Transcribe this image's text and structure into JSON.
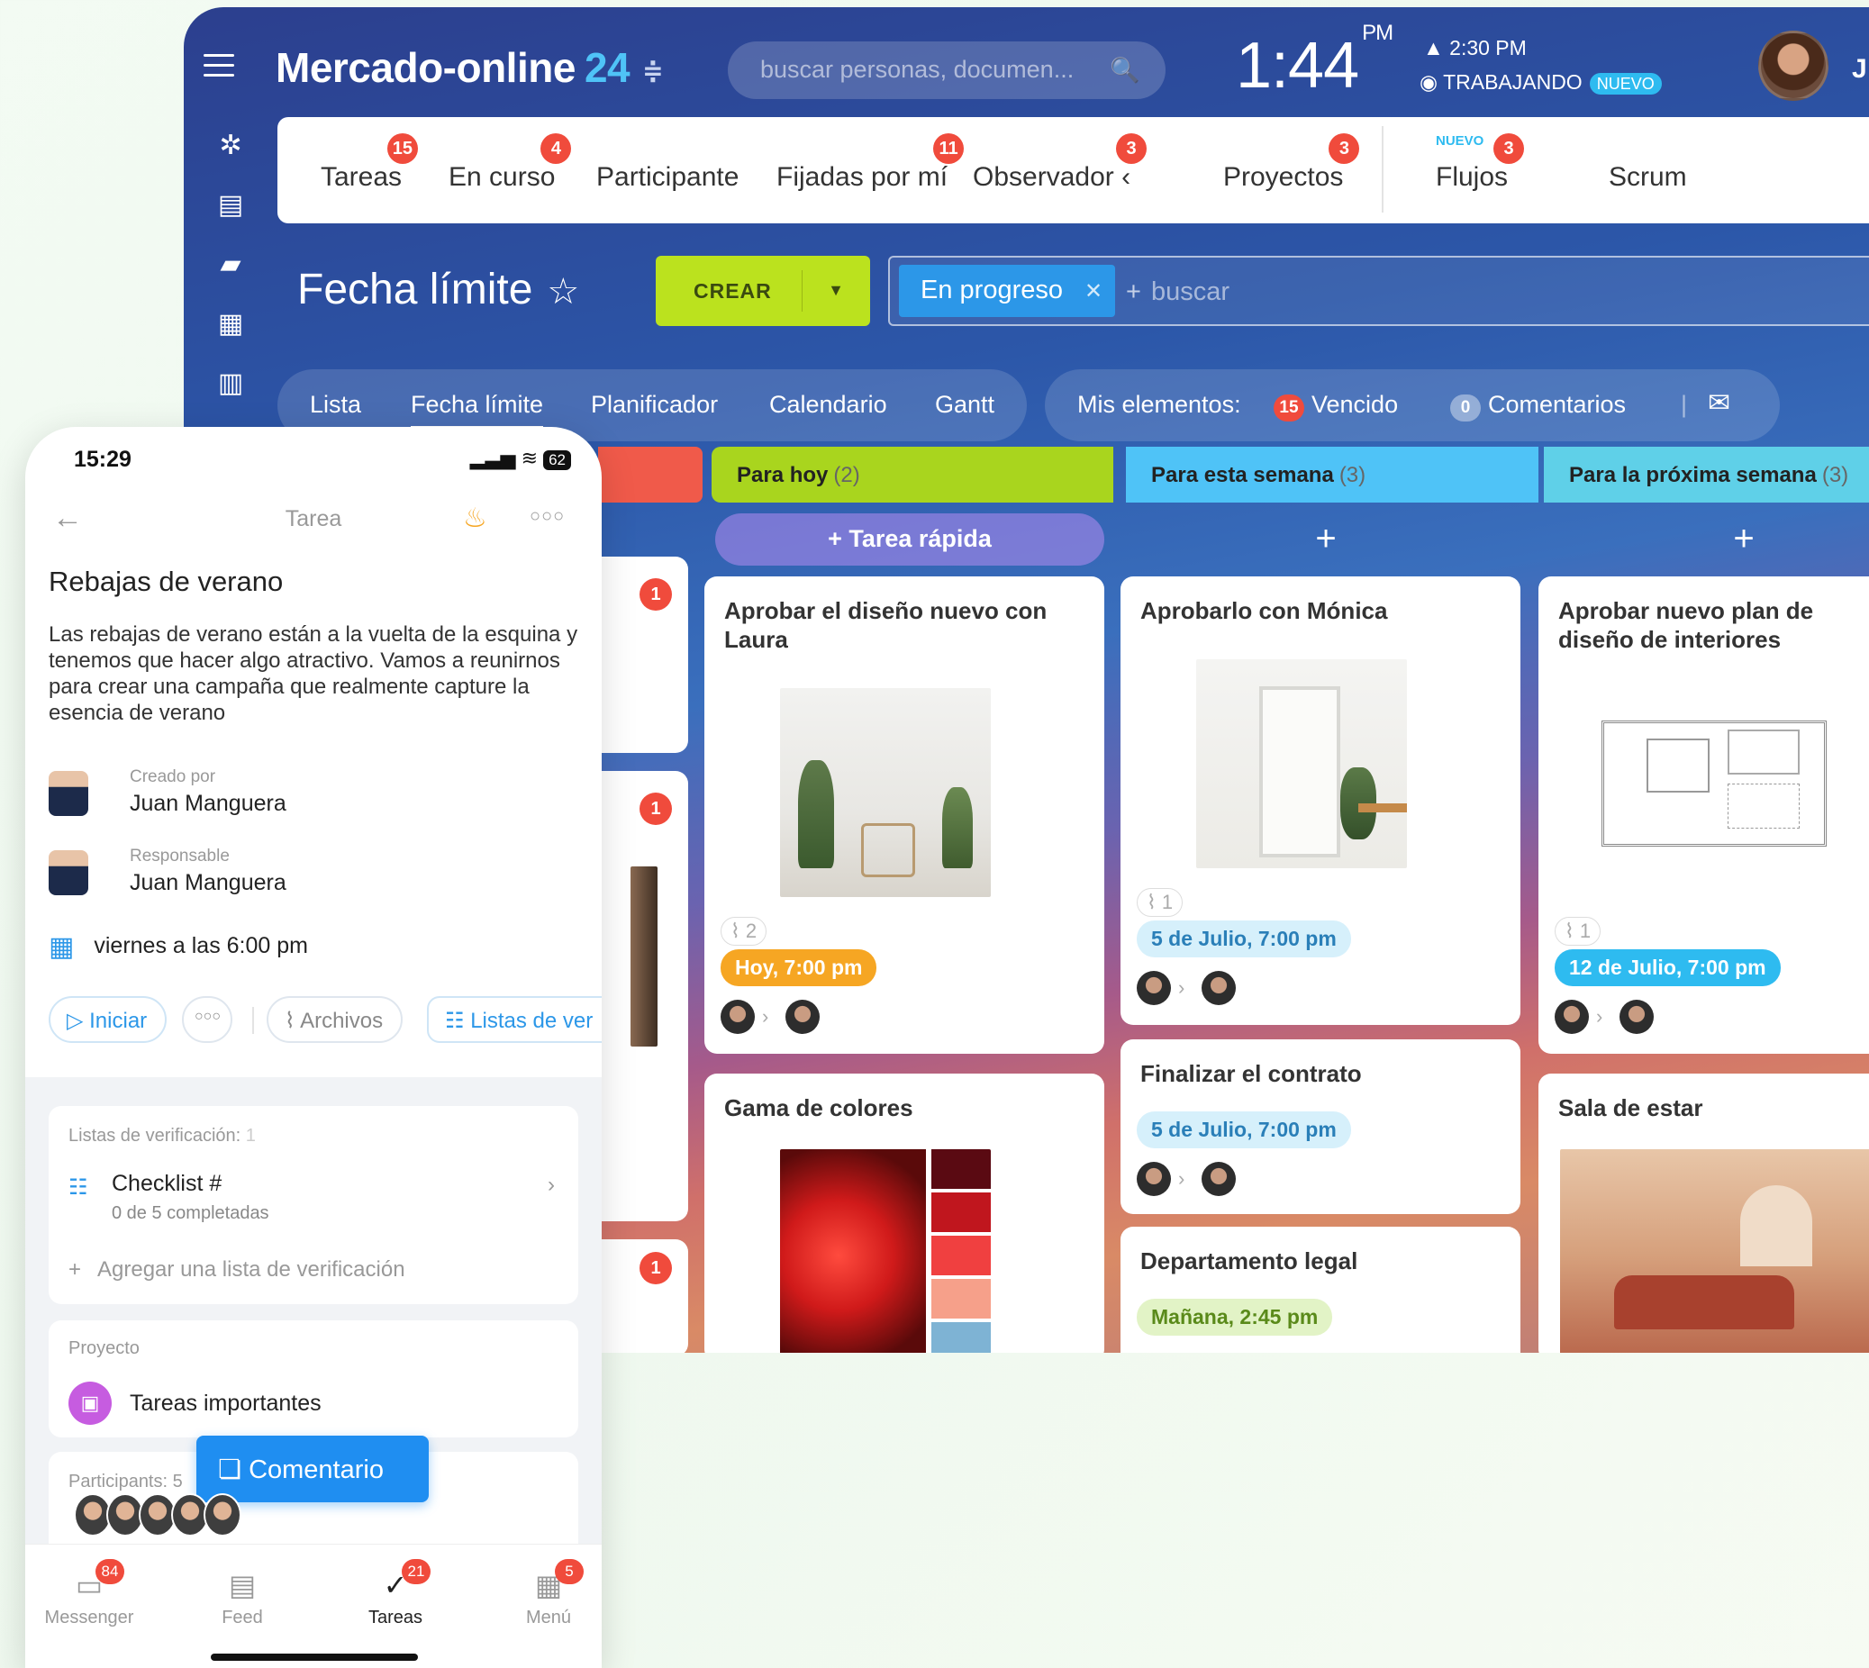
{
  "desktop": {
    "brand": "Mercado-online",
    "brand_num": "24",
    "search_placeholder": "buscar personas, documen...",
    "clock": "1:44",
    "clock_suffix": "PM",
    "alarm": "2:30 PM",
    "status": "TRABAJANDO",
    "status_badge": "NUEVO",
    "user_initial": "J",
    "tabs": [
      {
        "label": "Tareas",
        "count": "15"
      },
      {
        "label": "En curso",
        "count": "4"
      },
      {
        "label": "Participante",
        "count": ""
      },
      {
        "label": "Fijadas por mí",
        "count": "11"
      },
      {
        "label": "Observador",
        "count": "3"
      },
      {
        "label": "Proyectos",
        "count": "3"
      },
      {
        "label": "Flujos",
        "count": "3",
        "tag": "NUEVO"
      },
      {
        "label": "Scrum",
        "count": ""
      }
    ],
    "page_title": "Fecha límite",
    "create_label": "CREAR",
    "filter_chip": "En progreso",
    "filter_search": "buscar",
    "views": [
      "Lista",
      "Fecha límite",
      "Planificador",
      "Calendario",
      "Gantt"
    ],
    "mis_label": "Mis elementos:",
    "overdue_count": "15",
    "overdue_label": "Vencido",
    "comments_count": "0",
    "comments_label": "Comentarios",
    "columns": [
      {
        "title": "Para hoy",
        "count": "(2)",
        "color": "#a9d51e"
      },
      {
        "title": "Para esta semana",
        "count": "(3)",
        "color": "#4fc3f7"
      },
      {
        "title": "Para la próxima semana",
        "count": "(3)",
        "color": "#5fd0e8"
      }
    ],
    "quick_task": "+ Tarea rápida",
    "col_plus": "+",
    "overdue_dots": [
      "1",
      "1",
      "1"
    ],
    "cards": {
      "c1": {
        "title": "Aprobar el diseño nuevo con Laura",
        "attach": "2",
        "deadline": "Hoy, 7:00 pm"
      },
      "c2": {
        "title": "Gama de colores"
      },
      "c3": {
        "title": "Aprobarlo con Mónica",
        "attach": "1",
        "deadline": "5 de Julio, 7:00 pm"
      },
      "c4": {
        "title": "Finalizar el contrato",
        "deadline": "5 de Julio, 7:00 pm"
      },
      "c5": {
        "title": "Departamento legal",
        "deadline": "Mañana, 2:45 pm"
      },
      "c6": {
        "title": "Aprobar nuevo plan de diseño de interiores",
        "attach": "1",
        "deadline": "12 de Julio, 7:00 pm"
      },
      "c7": {
        "title": "Sala de estar"
      }
    }
  },
  "phone": {
    "time": "15:29",
    "battery": "62",
    "header": "Tarea",
    "task_title": "Rebajas de verano",
    "description": "Las rebajas de verano están a la vuelta de la esquina y tenemos que hacer algo atractivo. Vamos a reunirnos para crear una campaña que realmente capture la esencia de verano",
    "created_label": "Creado por",
    "created_value": "Juan Manguera",
    "responsible_label": "Responsable",
    "responsible_value": "Juan Manguera",
    "deadline": "viernes a las 6:00 pm",
    "start_btn": "Iniciar",
    "files_btn": "Archivos",
    "lists_btn": "Listas de ver",
    "checklists_label": "Listas de verificación:",
    "checklists_count": "1",
    "checklist_name": "Checklist #",
    "checklist_progress": "0 de 5 completadas",
    "add_checklist": "Agregar una lista de verificación",
    "project_label": "Proyecto",
    "project_name": "Tareas importantes",
    "participants_label": "Participants:",
    "participants_count": "5",
    "comment_btn": "Comentario",
    "nav": [
      {
        "label": "Messenger",
        "badge": "84"
      },
      {
        "label": "Feed",
        "badge": ""
      },
      {
        "label": "Tareas",
        "badge": "21"
      },
      {
        "label": "Menú",
        "badge": "5"
      }
    ]
  }
}
